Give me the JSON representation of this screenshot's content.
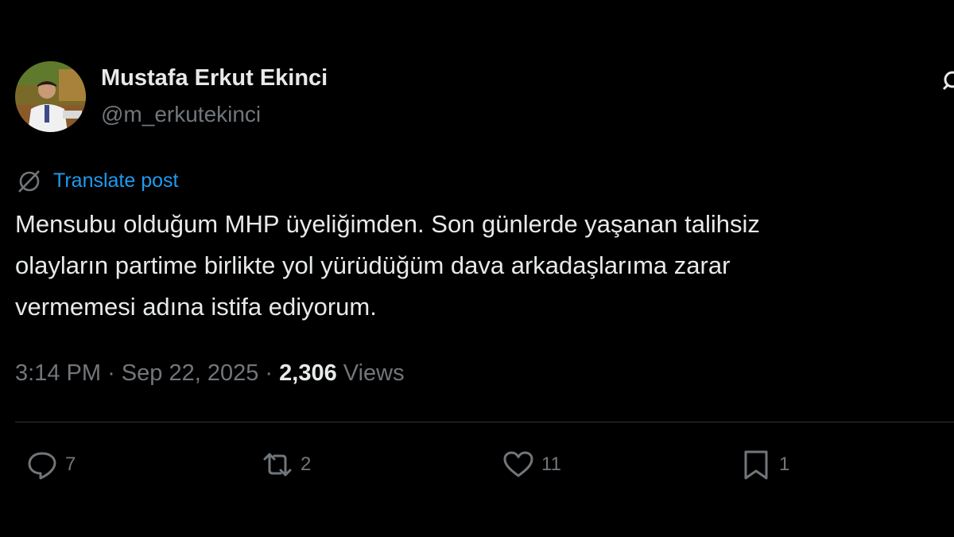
{
  "author": {
    "display_name": "Mustafa Erkut Ekinci",
    "handle": "@m_erkutekinci",
    "avatar_icon": "avatar-photo"
  },
  "translate": {
    "icon": "globe-icon",
    "label": "Translate post"
  },
  "post": {
    "lines": [
      "Mensubu olduğum MHP üyeliğimden. Son günlerde yaşanan talihsiz",
      "olayların partime birlikte yol yürüdüğüm dava arkadaşlarıma zarar",
      "vermemesi adına istifa ediyorum."
    ]
  },
  "meta": {
    "time": "3:14 PM",
    "separator": "·",
    "date": "Sep 22, 2025",
    "views_count": "2,306",
    "views_label": "Views"
  },
  "actions": {
    "reply": {
      "icon": "reply-icon",
      "count": "7"
    },
    "repost": {
      "icon": "repost-icon",
      "count": "2"
    },
    "like": {
      "icon": "heart-icon",
      "count": "11"
    },
    "bookmark": {
      "icon": "bookmark-icon",
      "count": "1"
    }
  },
  "colors": {
    "background": "#000000",
    "text_primary": "#e7e9ea",
    "text_secondary": "#71767b",
    "accent": "#1d9bf0",
    "divider": "#2f3336"
  }
}
